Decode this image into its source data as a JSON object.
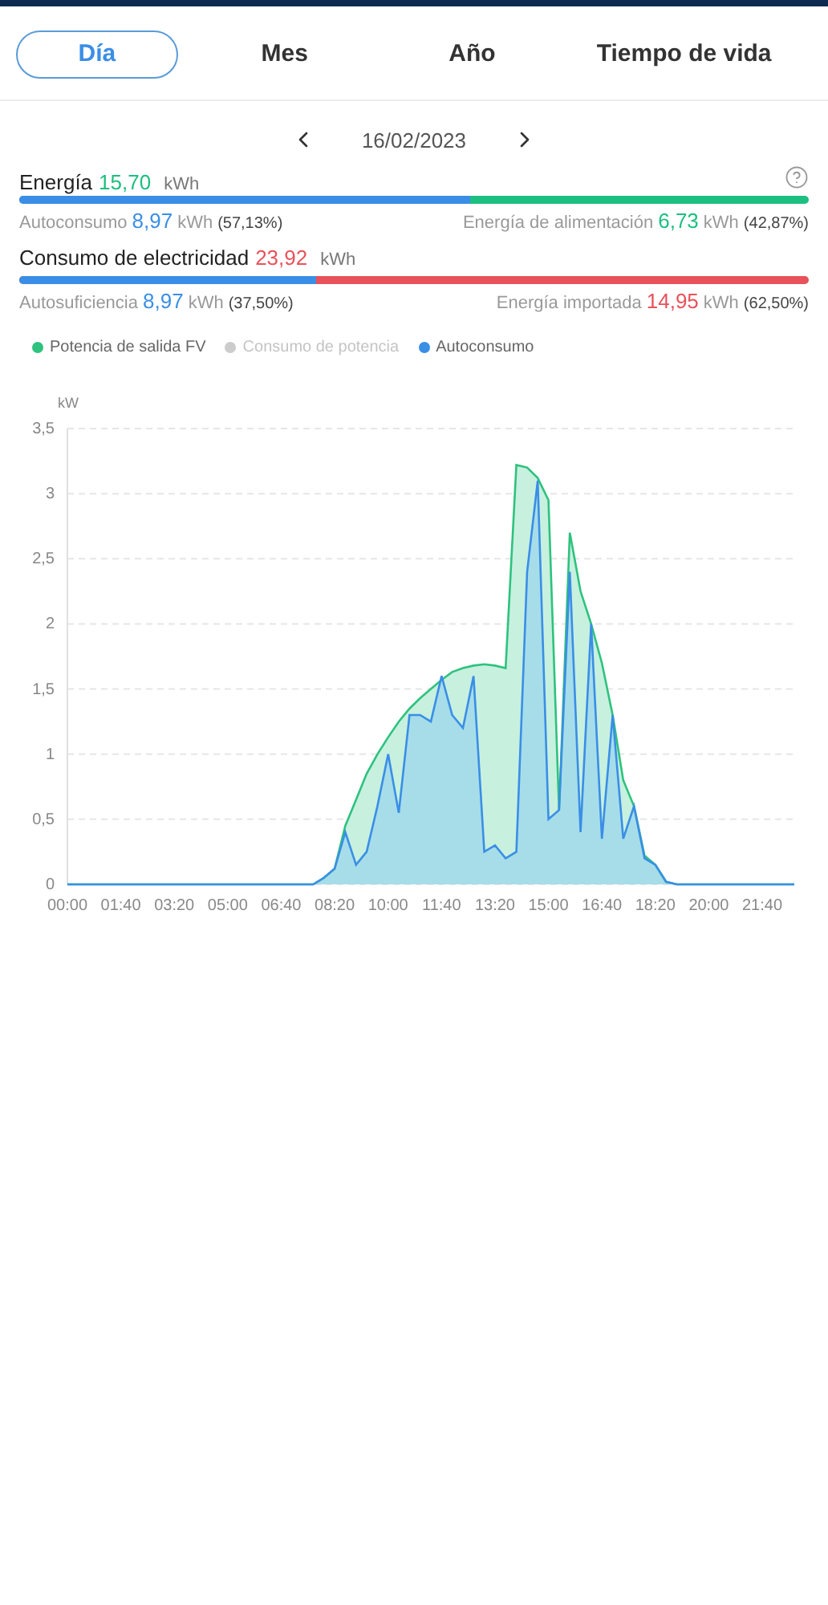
{
  "tabs": [
    {
      "label": "Día",
      "selected": true
    },
    {
      "label": "Mes",
      "selected": false
    },
    {
      "label": "Año",
      "selected": false
    },
    {
      "label": "Tiempo de vida",
      "selected": false
    }
  ],
  "date": "16/02/2023",
  "summaries": [
    {
      "title": "Energía",
      "value": "15,70",
      "unit": "kWh",
      "color": "#1dbf80",
      "help": true,
      "bar": {
        "level": 0.5713
      },
      "left": {
        "label": "Autoconsumo",
        "value": "8,97",
        "unit": "kWh",
        "percent": "(57,13%)",
        "color": "#3a8ee6"
      },
      "right": {
        "label": "Energía de alimentación",
        "value": "6,73",
        "unit": "kWh",
        "percent": "(42,87%)",
        "color": "#1dbf80"
      }
    },
    {
      "title": "Consumo de electricidad",
      "value": "23,92",
      "unit": "kWh",
      "color": "#e8525a",
      "help": false,
      "bar": {
        "level": 0.375
      },
      "left": {
        "label": "Autosuficiencia",
        "value": "8,97",
        "unit": "kWh",
        "percent": "(37,50%)",
        "color": "#3a8ee6"
      },
      "right": {
        "label": "Energía importada",
        "value": "14,95",
        "unit": "kWh",
        "percent": "(62,50%)",
        "color": "#e8525a"
      }
    }
  ],
  "legend": [
    {
      "kind": "series",
      "enabled": true
    },
    {
      "kind": "extra",
      "label": "Consumo de potencia",
      "color": "#cccccc",
      "enabled": false
    },
    {
      "kind": "series",
      "enabled": true
    }
  ],
  "chart_data": {
    "type": "area",
    "grid": true,
    "ylabel": "kW",
    "xlim": [
      0,
      1360
    ],
    "ylim": [
      0,
      3.5
    ],
    "yticks": [
      {
        "value": 0,
        "label": "0"
      },
      {
        "value": 0.5,
        "label": "0,5"
      },
      {
        "value": 1,
        "label": "1"
      },
      {
        "value": 1.5,
        "label": "1,5"
      },
      {
        "value": 2,
        "label": "2"
      },
      {
        "value": 2.5,
        "label": "2,5"
      },
      {
        "value": 3,
        "label": "3"
      },
      {
        "value": 3.5,
        "label": "3,5"
      }
    ],
    "xticks": [
      {
        "value": 0,
        "label": "00:00"
      },
      {
        "value": 100,
        "label": "01:40"
      },
      {
        "value": 200,
        "label": "03:20"
      },
      {
        "value": 300,
        "label": "05:00"
      },
      {
        "value": 400,
        "label": "06:40"
      },
      {
        "value": 500,
        "label": "08:20"
      },
      {
        "value": 600,
        "label": "10:00"
      },
      {
        "value": 700,
        "label": "11:40"
      },
      {
        "value": 800,
        "label": "13:20"
      },
      {
        "value": 900,
        "label": "15:00"
      },
      {
        "value": 1000,
        "label": "16:40"
      },
      {
        "value": 1100,
        "label": "18:20"
      },
      {
        "value": 1200,
        "label": "20:00"
      },
      {
        "value": 1300,
        "label": "21:40"
      }
    ],
    "x": [
      0,
      20,
      40,
      60,
      80,
      100,
      120,
      140,
      160,
      180,
      200,
      220,
      240,
      260,
      280,
      300,
      320,
      340,
      360,
      380,
      400,
      420,
      440,
      460,
      480,
      500,
      520,
      540,
      560,
      580,
      600,
      620,
      640,
      660,
      680,
      700,
      720,
      740,
      760,
      780,
      800,
      820,
      840,
      860,
      880,
      900,
      920,
      940,
      960,
      980,
      1000,
      1020,
      1040,
      1060,
      1080,
      1100,
      1120,
      1140,
      1160,
      1180,
      1200,
      1220,
      1240,
      1260,
      1280,
      1300,
      1320,
      1340,
      1360
    ],
    "series": [
      {
        "name": "Potencia de salida FV",
        "color": "#2ec27e",
        "values": [
          0,
          0,
          0,
          0,
          0,
          0,
          0,
          0,
          0,
          0,
          0,
          0,
          0,
          0,
          0,
          0,
          0,
          0,
          0,
          0,
          0,
          0,
          0,
          0,
          0.05,
          0.12,
          0.45,
          0.65,
          0.85,
          1.0,
          1.13,
          1.25,
          1.35,
          1.43,
          1.5,
          1.57,
          1.63,
          1.66,
          1.68,
          1.69,
          1.68,
          1.66,
          3.22,
          3.2,
          3.12,
          2.95,
          0.57,
          2.7,
          2.25,
          2.0,
          1.7,
          1.3,
          0.8,
          0.6,
          0.22,
          0.15,
          0.02,
          0,
          0,
          0,
          0,
          0,
          0,
          0,
          0,
          0,
          0,
          0,
          0
        ]
      },
      {
        "name": "Autoconsumo",
        "color": "#3a8ee6",
        "values": [
          0,
          0,
          0,
          0,
          0,
          0,
          0,
          0,
          0,
          0,
          0,
          0,
          0,
          0,
          0,
          0,
          0,
          0,
          0,
          0,
          0,
          0,
          0,
          0,
          0.05,
          0.12,
          0.4,
          0.15,
          0.25,
          0.6,
          1.0,
          0.55,
          1.3,
          1.3,
          1.25,
          1.6,
          1.3,
          1.2,
          1.6,
          0.25,
          0.3,
          0.2,
          0.25,
          2.4,
          3.1,
          0.5,
          0.57,
          2.4,
          0.4,
          2.0,
          0.35,
          1.3,
          0.35,
          0.6,
          0.2,
          0.15,
          0.02,
          0,
          0,
          0,
          0,
          0,
          0,
          0,
          0,
          0,
          0,
          0,
          0
        ]
      }
    ]
  }
}
